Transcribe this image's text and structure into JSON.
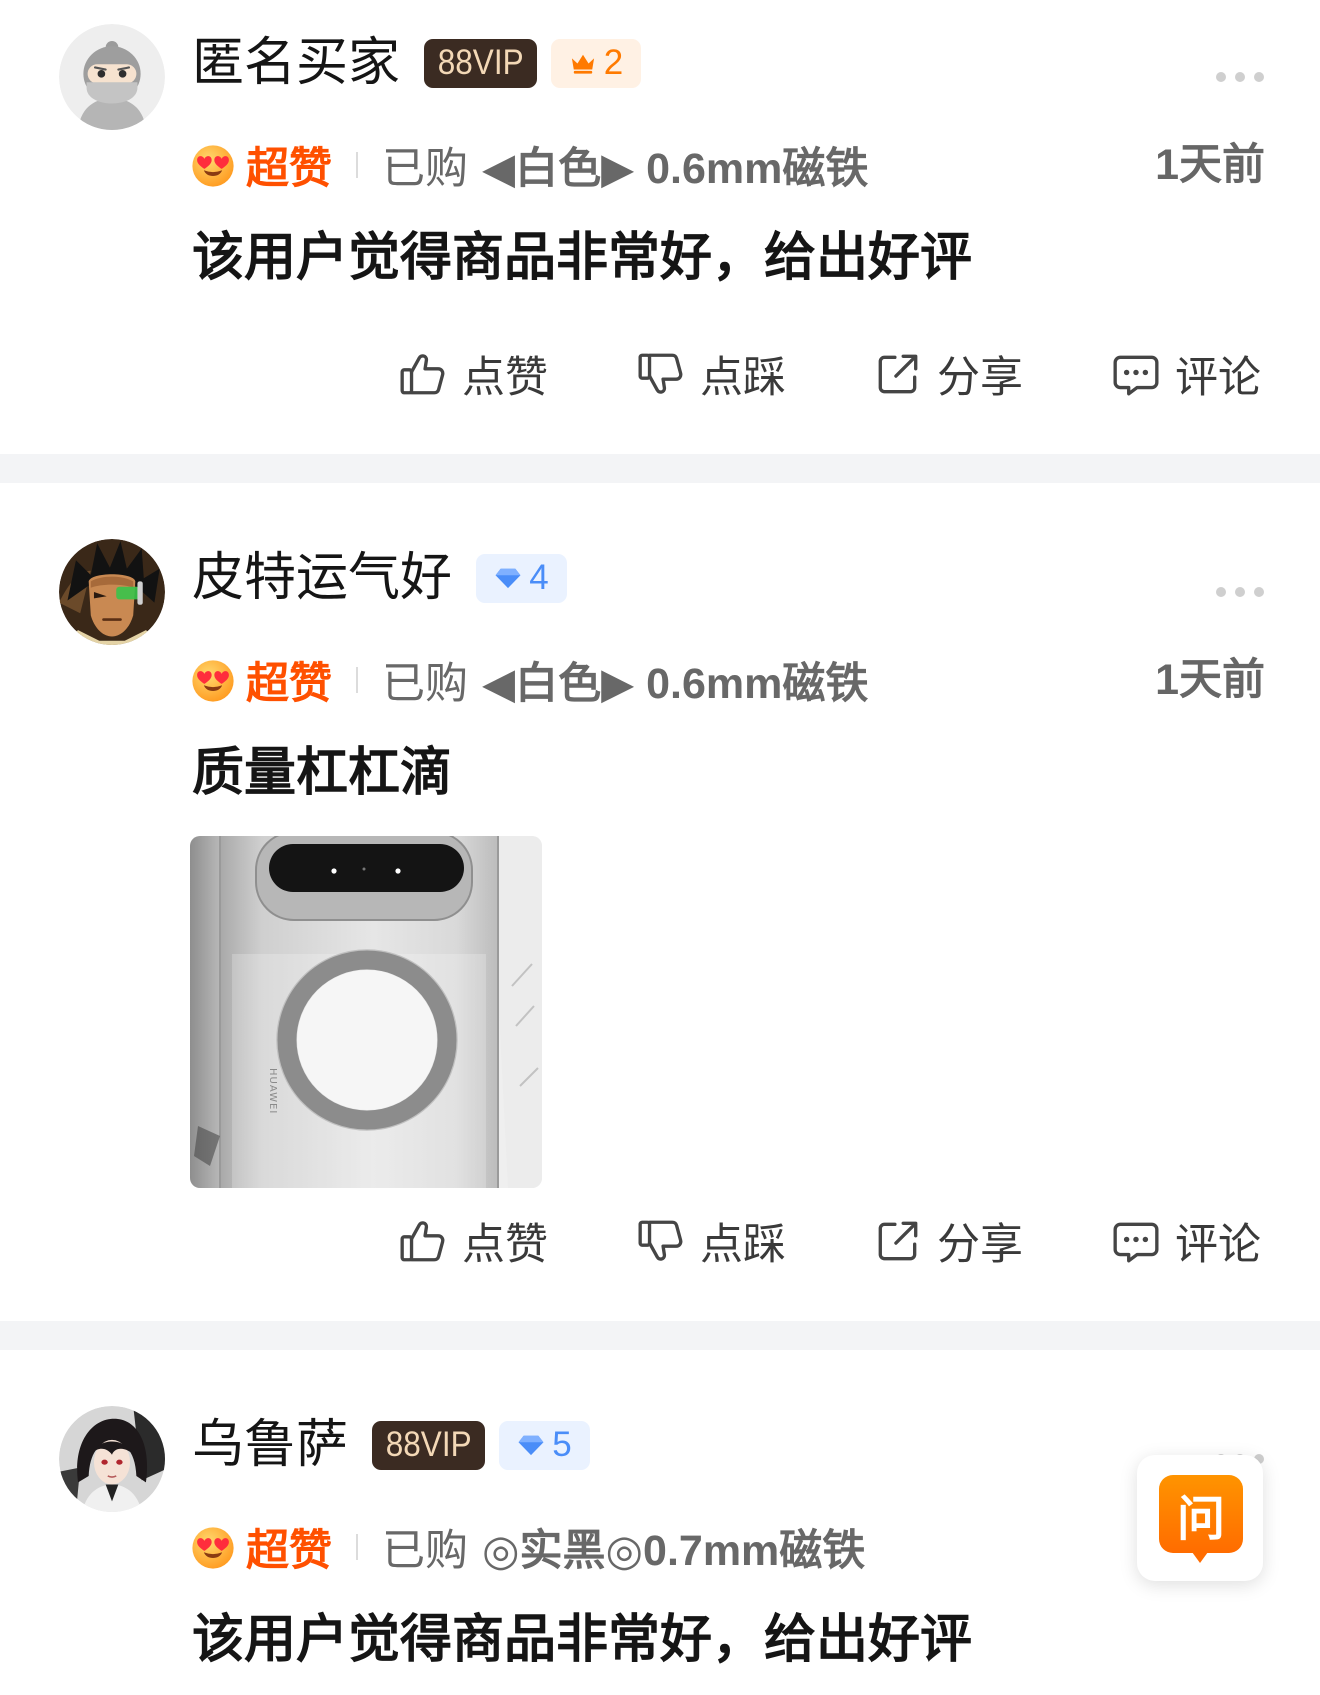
{
  "reviews": [
    {
      "user": {
        "name": "匿名买家",
        "avatar": "anonymous-ninja-avatar"
      },
      "badges": [
        {
          "type": "88vip",
          "text": "88VIP"
        },
        {
          "type": "crown-level",
          "icon": "crown-icon",
          "text": "2"
        }
      ],
      "rating": {
        "icon": "heart-eyes-emoji",
        "label": "超赞"
      },
      "purchased_label": "已购",
      "sku": "◀白色▶ 0.6mm磁铁",
      "time": "1天前",
      "content": "该用户觉得商品非常好，给出好评",
      "actions": {
        "like": "点赞",
        "dislike": "点踩",
        "share": "分享",
        "comment": "评论"
      }
    },
    {
      "user": {
        "name": "皮特运气好",
        "avatar": "anime-warrior-avatar"
      },
      "badges": [
        {
          "type": "diamond-level",
          "icon": "diamond-icon",
          "text": "4"
        }
      ],
      "rating": {
        "icon": "heart-eyes-emoji",
        "label": "超赞"
      },
      "purchased_label": "已购",
      "sku": "◀白色▶ 0.6mm磁铁",
      "time": "1天前",
      "content": "质量杠杠滴",
      "images": [
        {
          "icon": "product-photo",
          "lettering": "HUAWEI"
        }
      ],
      "actions": {
        "like": "点赞",
        "dislike": "点踩",
        "share": "分享",
        "comment": "评论"
      }
    },
    {
      "user": {
        "name": "乌鲁萨",
        "avatar": "anime-girl-avatar"
      },
      "badges": [
        {
          "type": "88vip",
          "text": "88VIP"
        },
        {
          "type": "diamond-level",
          "icon": "diamond-icon",
          "text": "5"
        }
      ],
      "rating": {
        "icon": "heart-eyes-emoji",
        "label": "超赞"
      },
      "purchased_label": "已购",
      "sku": "◎实黑◎0.7mm磁铁",
      "content": "该用户觉得商品非常好，给出好评"
    }
  ],
  "ask_button": {
    "label": "问"
  },
  "colors": {
    "rating_accent": "#ff5000",
    "vip_badge_bg": "#3b2b22",
    "vip_badge_text": "#f3d8b6",
    "crown_level": "#ff7a00",
    "diamond_level": "#4a8df8",
    "ask_button": "#ff7d00"
  }
}
